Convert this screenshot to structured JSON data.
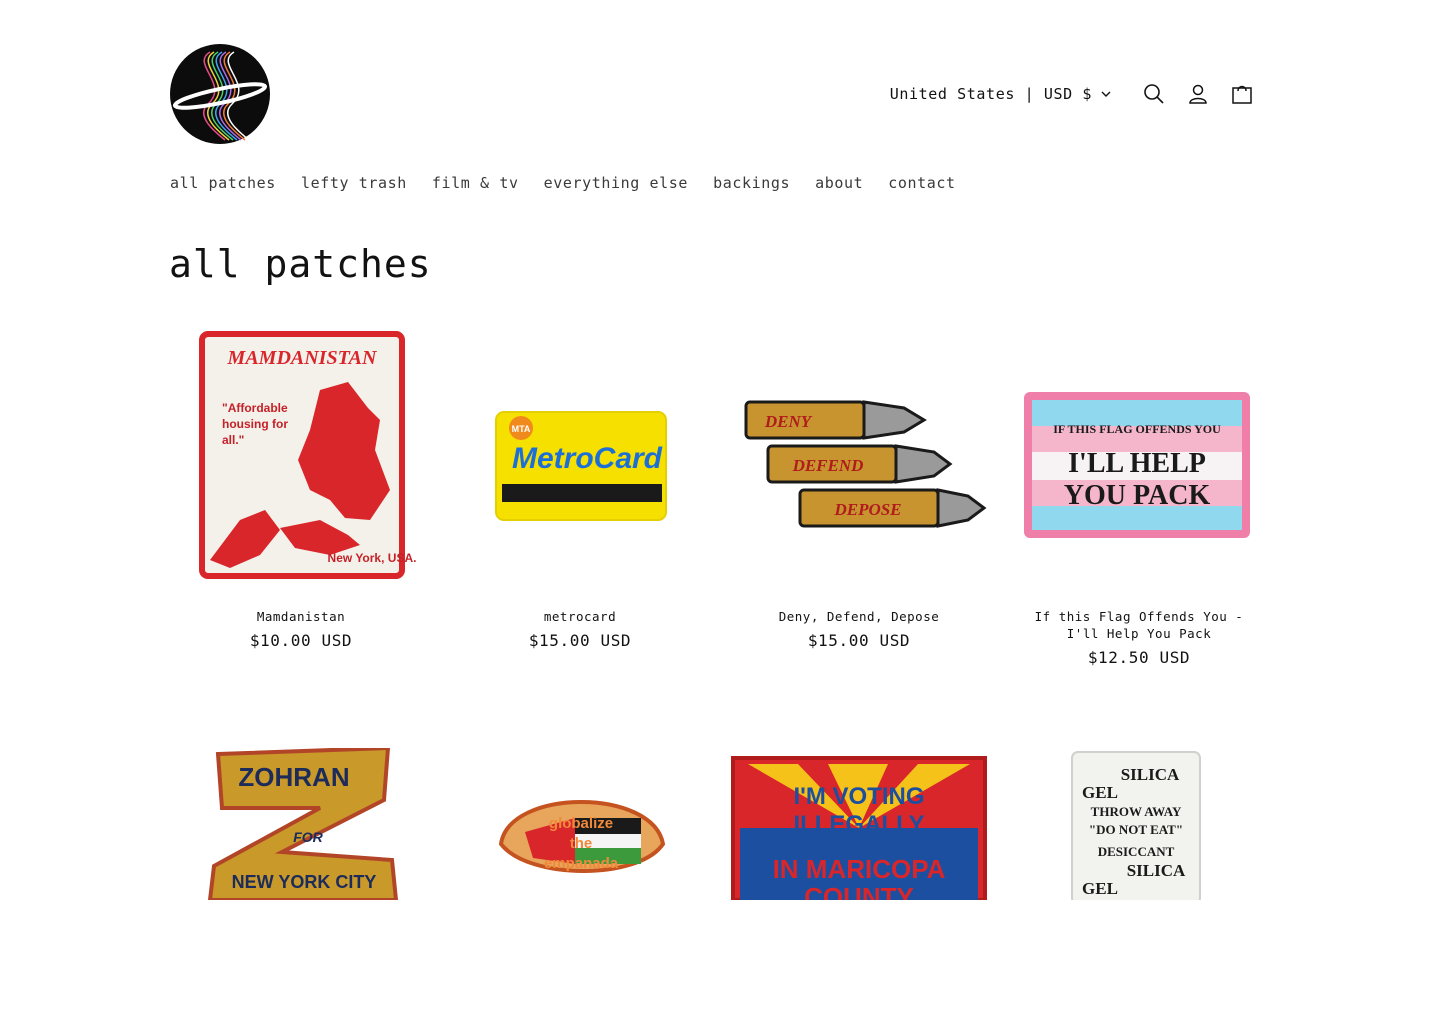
{
  "header": {
    "country_label": "United States | USD $",
    "icons": [
      "search-icon",
      "account-icon",
      "cart-icon"
    ]
  },
  "nav": {
    "items": [
      {
        "label": "all patches"
      },
      {
        "label": "lefty trash"
      },
      {
        "label": "film & tv"
      },
      {
        "label": "everything else"
      },
      {
        "label": "backings"
      },
      {
        "label": "about"
      },
      {
        "label": "contact"
      }
    ]
  },
  "page": {
    "title": "all patches"
  },
  "products": [
    {
      "title": "Mamdanistan",
      "price": "$10.00 USD",
      "art": {
        "heading": "MAMDANISTAN",
        "quote1": "\"Affordable",
        "quote2": "housing for",
        "quote3": "all.\"",
        "footer": "New York, USA."
      }
    },
    {
      "title": "metrocard",
      "price": "$15.00 USD",
      "art": {
        "badge": "MTA",
        "word": "MetroCard"
      }
    },
    {
      "title": "Deny, Defend, Depose",
      "price": "$15.00 USD",
      "art": {
        "w1": "DENY",
        "w2": "DEFEND",
        "w3": "DEPOSE"
      }
    },
    {
      "title": "If this Flag Offends You - I'll Help You Pack",
      "price": "$12.50 USD",
      "art": {
        "line1": "IF THIS FLAG OFFENDS YOU",
        "line2": "I'LL HELP",
        "line3": "YOU PACK"
      }
    },
    {
      "title": "",
      "price": "",
      "art": {
        "line1": "ZOHRAN",
        "line2": "FOR",
        "line3": "NEW YORK CITY"
      }
    },
    {
      "title": "",
      "price": "",
      "art": {
        "line1": "globalize",
        "line2": "the",
        "line3": "empanada"
      }
    },
    {
      "title": "",
      "price": "",
      "art": {
        "line1": "I'M VOTING",
        "line2": "ILLEGALLY",
        "line3": "IN MARICOPA",
        "line4": "COUNTY"
      }
    },
    {
      "title": "",
      "price": "",
      "art": {
        "line1": "SILICA",
        "line2": "GEL",
        "line3": "THROW AWAY",
        "line4": "\"DO NOT EAT\"",
        "line5": "DESICCANT",
        "line6": "SILICA",
        "line7": "GEL"
      }
    }
  ]
}
